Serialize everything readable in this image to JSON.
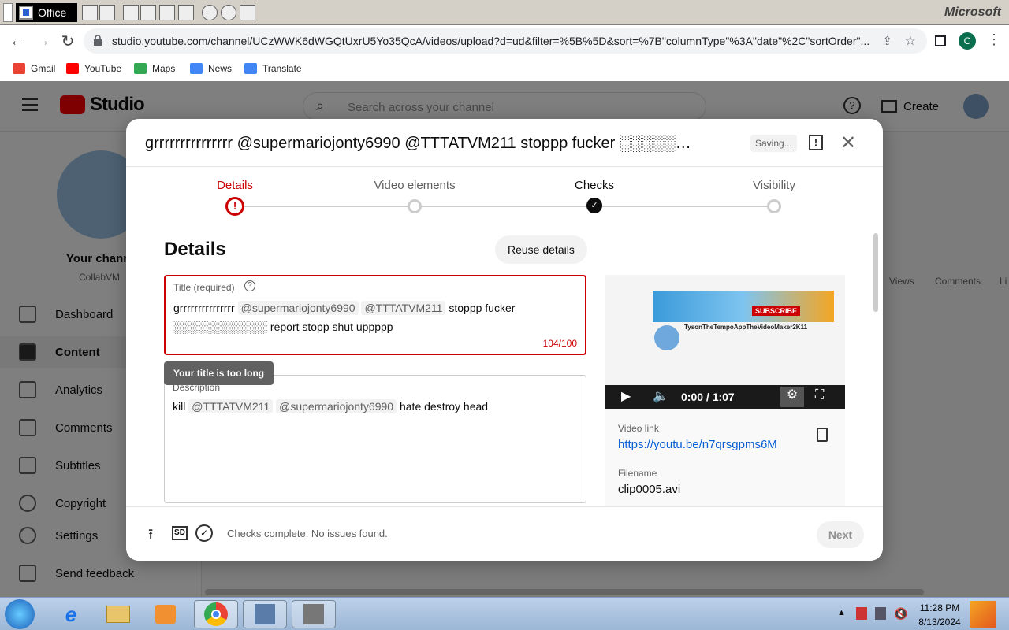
{
  "officebar": {
    "label": "Office",
    "brand": "Microsoft"
  },
  "browser": {
    "url": "studio.youtube.com/channel/UCzWWK6dWGQtUxrU5Yo35QcA/videos/upload?d=ud&filter=%5B%5D&sort=%7B\"columnType\"%3A\"date\"%2C\"sortOrder\"...",
    "bookmarks": [
      "Gmail",
      "YouTube",
      "Maps",
      "News",
      "Translate"
    ],
    "profile_letter": "C"
  },
  "studio": {
    "logo_text": "Studio",
    "search_placeholder": "Search across your channel",
    "create_label": "Create",
    "channel_name": "Your chann",
    "channel_sub": "CollabVM",
    "sidebar": [
      "Dashboard",
      "Content",
      "Analytics",
      "Comments",
      "Subtitles",
      "Copyright",
      "Settings",
      "Send feedback"
    ],
    "table_cols": [
      "Views",
      "Comments",
      "Li"
    ]
  },
  "dialog": {
    "title": "grrrrrrrrrrrrrrr @supermariojonty6990 @TTTATVM211 stoppp fucker ░░░░░░░...",
    "status": "Saving...",
    "steps": [
      "Details",
      "Video elements",
      "Checks",
      "Visibility"
    ],
    "heading": "Details",
    "reuse_label": "Reuse details",
    "title_field": {
      "label": "Title (required)",
      "text_start": "grrrrrrrrrrrrrrr ",
      "mention1": "@supermariojonty6990",
      "mention2": "@TTTATVM211",
      "text_end": " stoppp fucker ░░░░░░░░░░░░ report stopp shut uppppp",
      "count": "104/100",
      "error": "Your title is too long"
    },
    "desc_field": {
      "label": "Description",
      "text_start": "kill ",
      "mention1": "@TTTATVM211",
      "mention2": "@supermariojonty6990",
      "text_end": " hate destroy head"
    },
    "preview": {
      "time": "0:00 / 1:07",
      "channel_in_thumb": "TysonTheTempoAppTheVideoMaker2K11",
      "subscribe": "SUBSCRIBE",
      "video_link_label": "Video link",
      "video_link": "https://youtu.be/n7qrsgpms6M",
      "filename_label": "Filename",
      "filename": "clip0005.avi"
    },
    "footer_status": "Checks complete. No issues found.",
    "next_label": "Next",
    "sd_label": "SD"
  },
  "taskbar": {
    "time": "11:28 PM",
    "date": "8/13/2024"
  },
  "colors": {
    "error": "#cc0000",
    "link": "#065fd4",
    "overlay": "rgba(0,0,0,0.5)"
  }
}
